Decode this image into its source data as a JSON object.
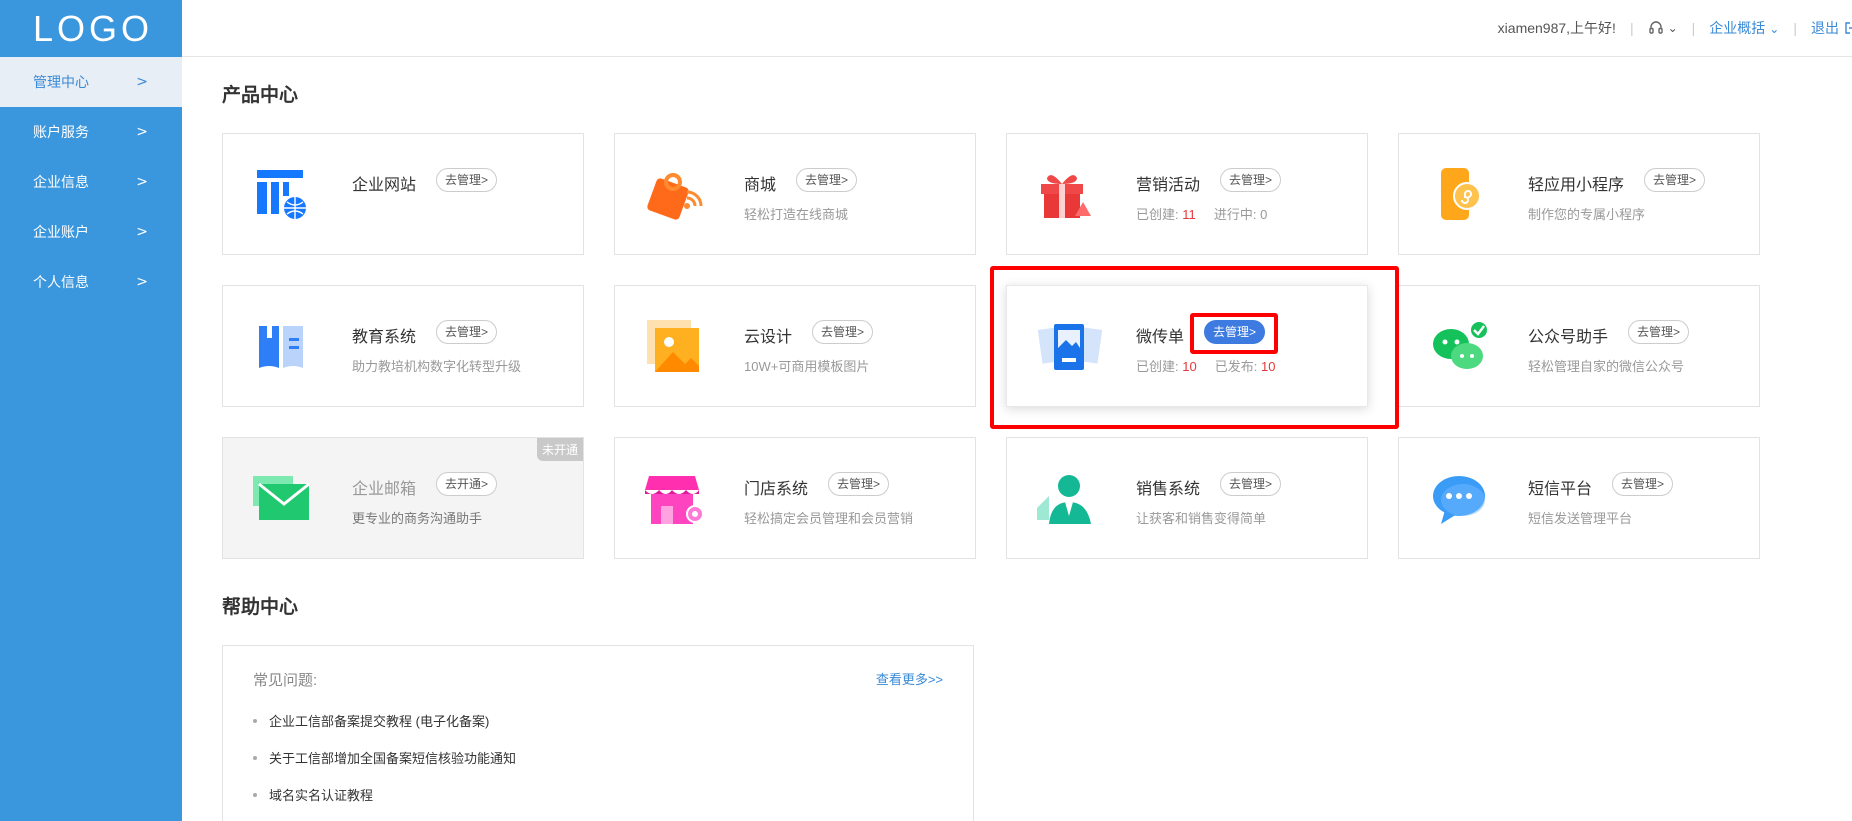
{
  "sidebar": {
    "logo": "LOGO",
    "items": [
      {
        "label": "管理中心",
        "active": true
      },
      {
        "label": "账户服务"
      },
      {
        "label": "企业信息"
      },
      {
        "label": "企业账户"
      },
      {
        "label": "个人信息"
      }
    ],
    "chevron": ">"
  },
  "header": {
    "greeting": "xiamen987,上午好!",
    "support_icon": "headset-icon",
    "overview": "企业概括",
    "logout": "退出"
  },
  "products": {
    "title": "产品中心",
    "cards": [
      {
        "title": "企业网站",
        "button": "去管理>",
        "desc": "",
        "icon": "website-icon"
      },
      {
        "title": "商城",
        "button": "去管理>",
        "desc": "轻松打造在线商城",
        "icon": "shopping-bag-icon"
      },
      {
        "title": "营销活动",
        "button": "去管理>",
        "stat1_label": "已创建:",
        "stat1_value": "11",
        "stat2_label": "进行中:",
        "stat2_value": "0",
        "icon": "gift-icon"
      },
      {
        "title": "轻应用小程序",
        "button": "去管理>",
        "desc": "制作您的专属小程序",
        "icon": "mini-program-icon"
      },
      {
        "title": "教育系统",
        "button": "去管理>",
        "desc": "助力教培机构数字化转型升级",
        "icon": "book-icon"
      },
      {
        "title": "云设计",
        "button": "去管理>",
        "desc": "10W+可商用模板图片",
        "icon": "image-icon"
      },
      {
        "title": "微传单",
        "button": "去管理>",
        "stat1_label": "已创建:",
        "stat1_value": "10",
        "stat2_label": "已发布:",
        "stat2_value": "10",
        "icon": "flyer-icon"
      },
      {
        "title": "公众号助手",
        "button": "去管理>",
        "desc": "轻松管理自家的微信公众号",
        "icon": "wechat-icon"
      },
      {
        "title": "企业邮箱",
        "button": "去开通>",
        "desc": "更专业的商务沟通助手",
        "badge": "未开通",
        "icon": "mail-icon"
      },
      {
        "title": "门店系统",
        "button": "去管理>",
        "desc": "轻松搞定会员管理和会员营销",
        "icon": "store-icon"
      },
      {
        "title": "销售系统",
        "button": "去管理>",
        "desc": "让获客和销售变得简单",
        "icon": "salesperson-icon"
      },
      {
        "title": "短信平台",
        "button": "去管理>",
        "desc": "短信发送管理平台",
        "icon": "sms-icon"
      }
    ]
  },
  "help": {
    "title": "帮助中心",
    "heading": "常见问题:",
    "more": "查看更多>>",
    "items": [
      "企业工信部备案提交教程 (电子化备案)",
      "关于工信部增加全国备案短信核验功能通知",
      "域名实名认证教程"
    ]
  }
}
